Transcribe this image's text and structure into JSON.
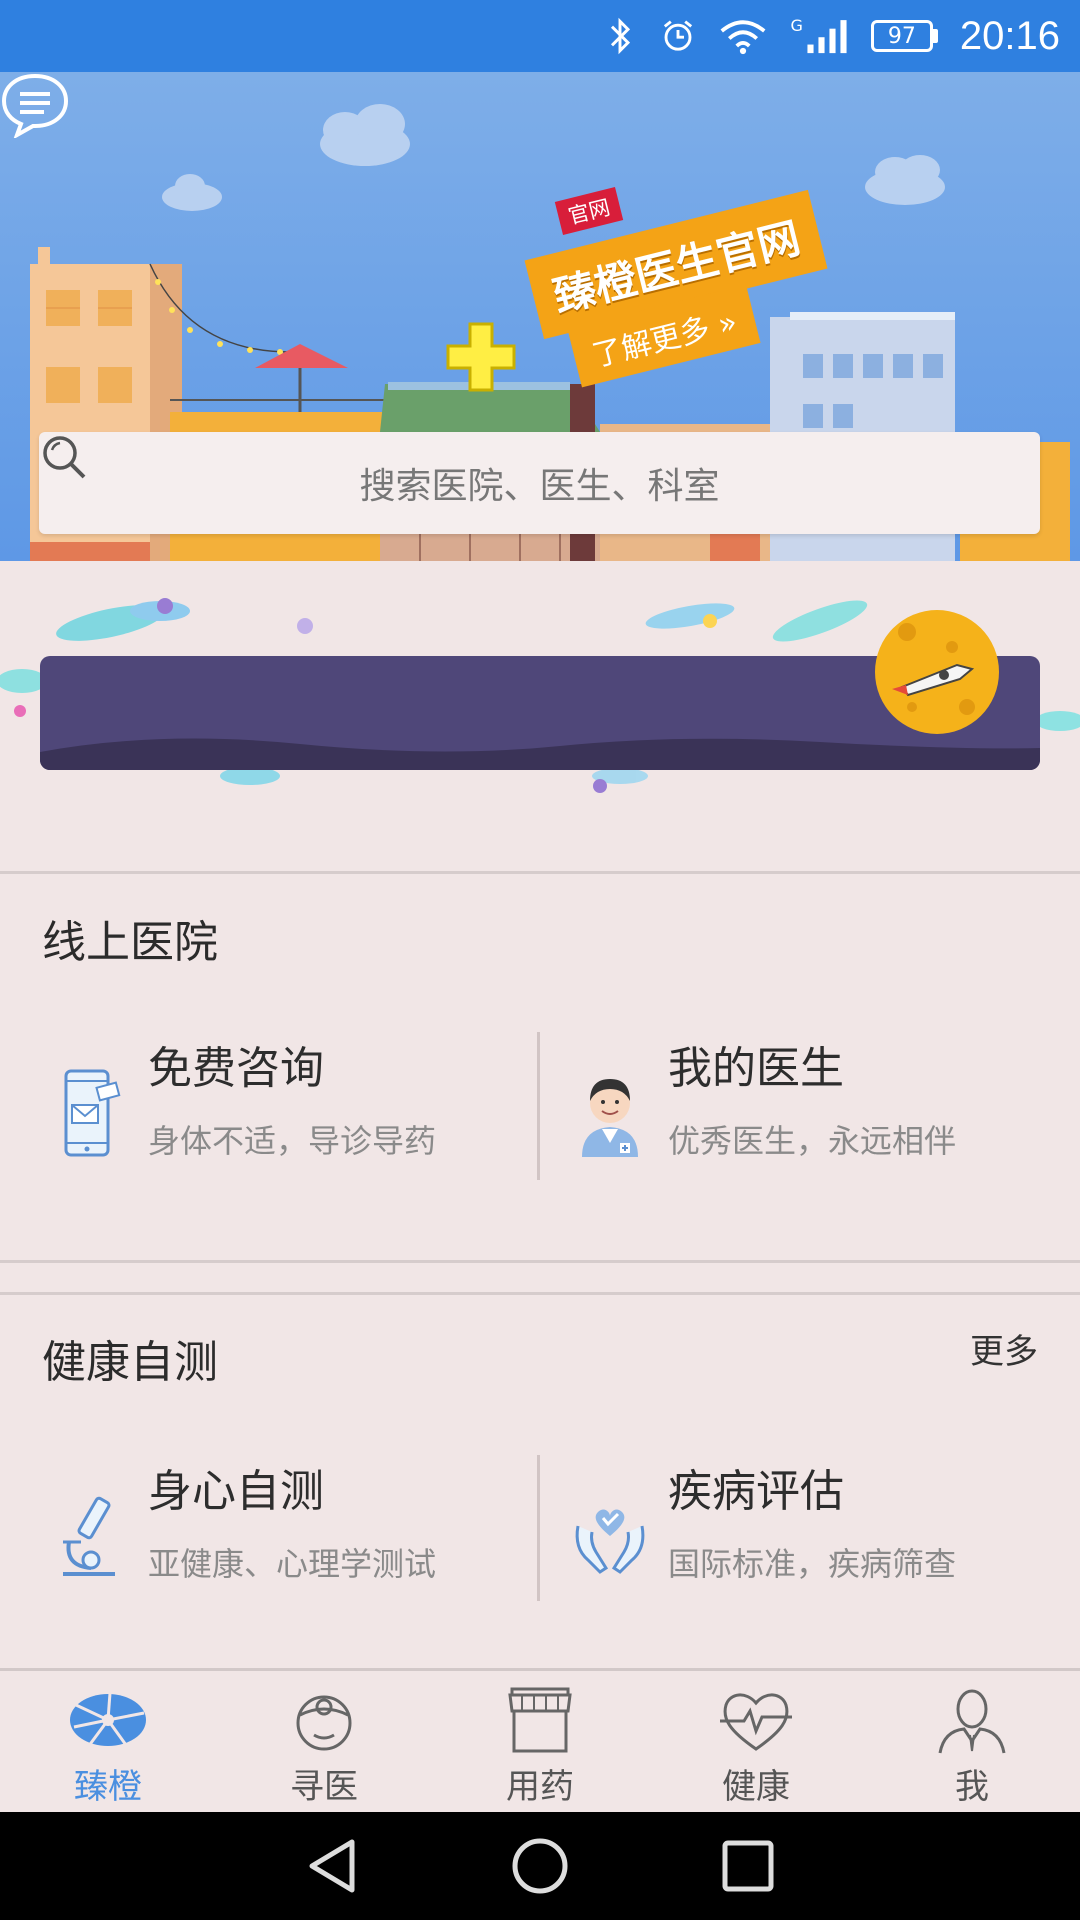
{
  "status_bar": {
    "time": "20:16",
    "battery": "97",
    "network_label": "G",
    "icons": [
      "bluetooth-icon",
      "alarm-icon",
      "wifi-icon",
      "signal-icon",
      "battery-icon"
    ]
  },
  "hero": {
    "badge_small": "官网",
    "badge_main": "臻橙医生官网",
    "badge_more": "了解更多 »",
    "search_placeholder": "搜索医院、医生、科室"
  },
  "online_hospital": {
    "title": "线上医院",
    "cards": [
      {
        "title": "免费咨询",
        "subtitle": "身体不适，导诊导药",
        "icon": "phone-mail-icon"
      },
      {
        "title": "我的医生",
        "subtitle": "优秀医生，永远相伴",
        "icon": "doctor-avatar-icon"
      }
    ]
  },
  "health_test": {
    "title": "健康自测",
    "more": "更多",
    "cards": [
      {
        "title": "身心自测",
        "subtitle": "亚健康、心理学测试",
        "icon": "microscope-icon"
      },
      {
        "title": "疾病评估",
        "subtitle": "国际标准，疾病筛查",
        "icon": "heart-hands-icon"
      }
    ]
  },
  "bottom_nav": {
    "items": [
      {
        "label": "臻橙",
        "icon": "zhencheng-logo-icon",
        "active": true
      },
      {
        "label": "寻医",
        "icon": "doctor-icon",
        "active": false
      },
      {
        "label": "用药",
        "icon": "pharmacy-icon",
        "active": false
      },
      {
        "label": "健康",
        "icon": "heartbeat-icon",
        "active": false
      },
      {
        "label": "我",
        "icon": "profile-icon",
        "active": false
      }
    ]
  },
  "colors": {
    "status_bar": "#2f80e0",
    "accent": "#4a8fe0",
    "badge_orange": "#f4a316",
    "banner_purple": "#4f4779"
  }
}
